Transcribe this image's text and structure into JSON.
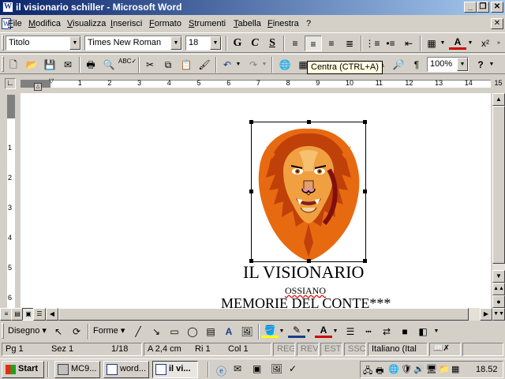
{
  "window": {
    "title": "il visionario schiller - Microsoft Word"
  },
  "menu": [
    "File",
    "Modifica",
    "Visualizza",
    "Inserisci",
    "Formato",
    "Strumenti",
    "Tabella",
    "Finestra",
    "?"
  ],
  "formatting": {
    "style": "Titolo",
    "font": "Times New Roman",
    "size": "18",
    "bold": "G",
    "italic": "C",
    "underline": "S"
  },
  "standard": {
    "zoom": "100%",
    "paragraph_mark": "¶"
  },
  "tooltip": "Centra (CTRL+A)",
  "ruler": {
    "h_ticks": [
      "1",
      "2",
      "3",
      "4",
      "5",
      "6",
      "7",
      "8",
      "9",
      "10",
      "11",
      "12",
      "13",
      "14",
      "15"
    ],
    "v_ticks": [
      "1",
      "2",
      "3",
      "4",
      "5",
      "6"
    ]
  },
  "document": {
    "title": "IL VISIONARIO",
    "subtitle": "OSSIANO",
    "line3": "MEMORIE DEL CONTE***"
  },
  "drawing": {
    "draw": "Disegno",
    "shapes": "Forme"
  },
  "status": {
    "page": "Pg 1",
    "section": "Sez 1",
    "pages": "1/18",
    "at": "A 2,4 cm",
    "line": "Ri 1",
    "col": "Col 1",
    "rec": "REG",
    "rev": "REV",
    "ext": "EST",
    "ovr": "SSC",
    "language": "Italiano (Ital"
  },
  "taskbar": {
    "start": "Start",
    "tasks": [
      "MC9...",
      "word...",
      "il vi..."
    ],
    "clock": "18.52"
  },
  "colors": {
    "title_start": "#0a246a",
    "title_end": "#a6caf0",
    "font_color": "#d00000",
    "highlight": "#ffff00"
  }
}
